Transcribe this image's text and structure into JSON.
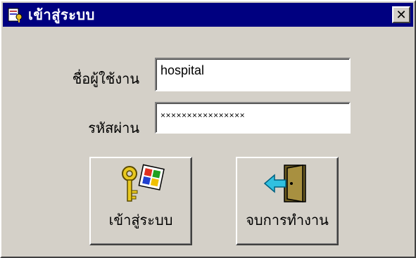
{
  "window": {
    "title": "เข้าสู่ระบบ",
    "close_label": "✕"
  },
  "form": {
    "username_label": "ชื่อผู้ใช้งาน",
    "username_value": "hospital",
    "password_label": "รหัสผ่าน",
    "password_value": "××××××××××××××××"
  },
  "buttons": {
    "login_label": "เข้าสู่ระบบ",
    "exit_label": "จบการทำงาน"
  },
  "icons": {
    "app": "login-app-icon",
    "login": "key-windows-icon",
    "exit": "door-exit-icon"
  },
  "colors": {
    "titlebar": "#000080",
    "face": "#d4d0c8"
  }
}
